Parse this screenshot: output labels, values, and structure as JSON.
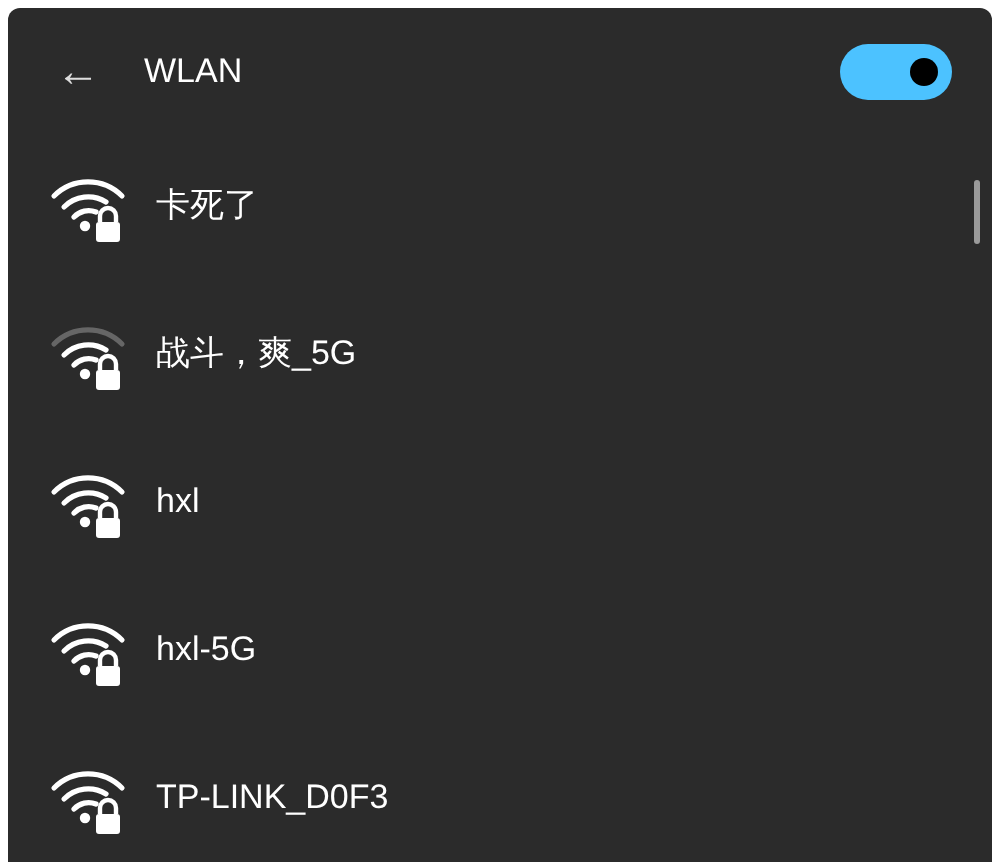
{
  "header": {
    "back": "←",
    "title": "WLAN",
    "toggle": {
      "on": true
    }
  },
  "networks": [
    {
      "name": "卡死了",
      "kind": "full"
    },
    {
      "name": "战斗，爽_5G",
      "kind": "three-bar"
    },
    {
      "name": "hxl",
      "kind": "full"
    },
    {
      "name": "hxl-5G",
      "kind": "full"
    },
    {
      "name": "TP-LINK_D0F3",
      "kind": "full"
    }
  ]
}
